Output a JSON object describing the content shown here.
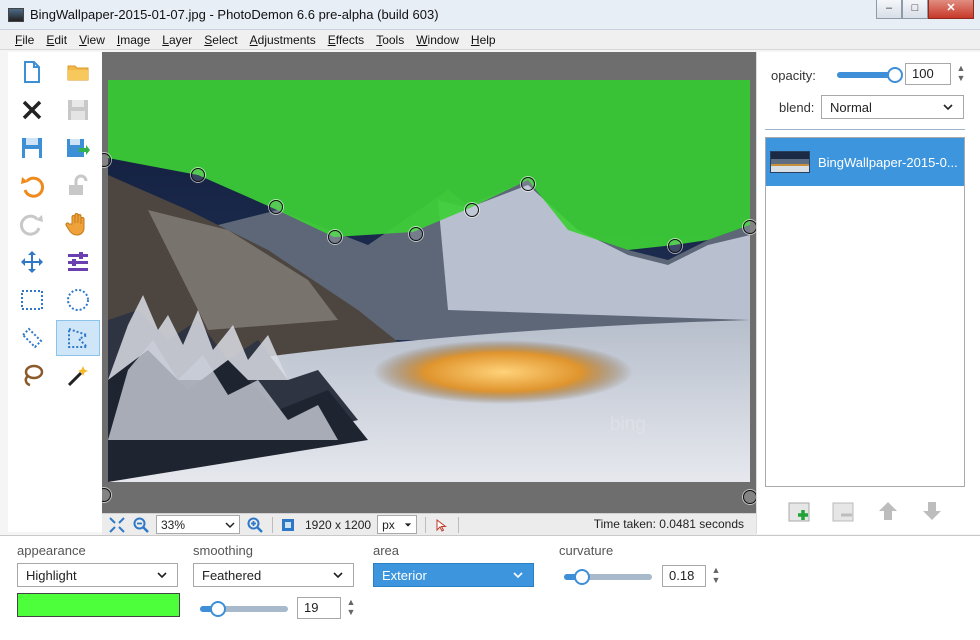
{
  "window": {
    "title": "BingWallpaper-2015-01-07.jpg  -  PhotoDemon 6.6 pre-alpha (build 603)",
    "minimize": "–",
    "maximize": "□",
    "close": "✕"
  },
  "menu": [
    "File",
    "Edit",
    "View",
    "Image",
    "Layer",
    "Select",
    "Adjustments",
    "Effects",
    "Tools",
    "Window",
    "Help"
  ],
  "toolbox": {
    "tools": [
      {
        "name": "new-file-icon"
      },
      {
        "name": "open-folder-icon"
      },
      {
        "name": "close-icon"
      },
      {
        "name": "save-icon"
      },
      {
        "name": "save-as-icon"
      },
      {
        "name": "export-icon"
      },
      {
        "name": "undo-icon"
      },
      {
        "name": "revert-icon"
      },
      {
        "name": "redo-icon"
      },
      {
        "name": "hand-pan-icon"
      },
      {
        "name": "move-icon"
      },
      {
        "name": "layer-options-icon"
      },
      {
        "name": "rect-select-icon"
      },
      {
        "name": "ellipse-select-icon"
      },
      {
        "name": "line-select-icon"
      },
      {
        "name": "polygon-select-icon"
      },
      {
        "name": "lasso-select-icon"
      },
      {
        "name": "magic-wand-icon"
      }
    ],
    "active": "polygon-select-icon"
  },
  "image": {
    "watermark": "bing"
  },
  "statusbar": {
    "zoom": "33%",
    "dimensions": "1920 x 1200",
    "unit": "px",
    "time_taken": "Time taken: 0.0481 seconds"
  },
  "layers_panel": {
    "opacity_label": "opacity:",
    "opacity_value": "100",
    "opacity_fraction": 1.0,
    "blend_label": "blend:",
    "blend_value": "Normal",
    "layers": [
      {
        "name": "BingWallpaper-2015-0...",
        "selected": true
      }
    ]
  },
  "selection_options": {
    "appearance_label": "appearance",
    "appearance_value": "Highlight",
    "highlight_color": "#4cff3a",
    "smoothing_label": "smoothing",
    "smoothing_value": "Feathered",
    "feather_value": "19",
    "area_label": "area",
    "area_value": "Exterior",
    "curvature_label": "curvature",
    "curvature_value": "0.18"
  },
  "colors": {
    "accent": "#3d96dd",
    "highlight": "#4cff3a"
  }
}
